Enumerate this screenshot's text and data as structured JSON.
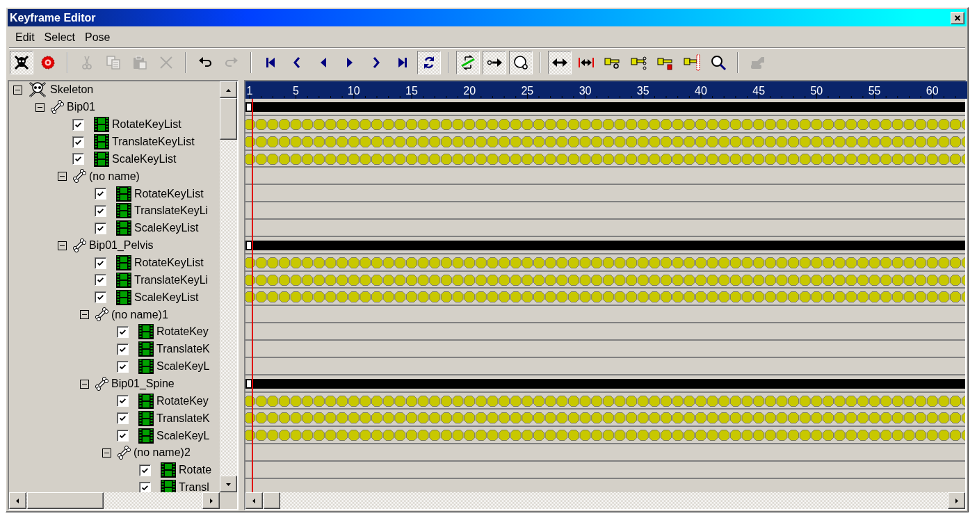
{
  "window": {
    "title": "Keyframe Editor"
  },
  "menu": [
    {
      "label": "Edit"
    },
    {
      "label": "Select"
    },
    {
      "label": "Pose"
    }
  ],
  "toolbar": [
    {
      "kind": "skeleton",
      "pressed": true,
      "disabled": false
    },
    {
      "kind": "target",
      "pressed": false,
      "disabled": false
    },
    {
      "kind": "separator"
    },
    {
      "kind": "cut",
      "pressed": false,
      "disabled": true
    },
    {
      "kind": "copy",
      "pressed": false,
      "disabled": true
    },
    {
      "kind": "paste",
      "pressed": false,
      "disabled": true
    },
    {
      "kind": "delete",
      "pressed": false,
      "disabled": true
    },
    {
      "kind": "separator"
    },
    {
      "kind": "undo",
      "pressed": false,
      "disabled": false
    },
    {
      "kind": "redo",
      "pressed": false,
      "disabled": true
    },
    {
      "kind": "separator"
    },
    {
      "kind": "first",
      "pressed": false,
      "disabled": false
    },
    {
      "kind": "prevkey",
      "pressed": false,
      "disabled": false
    },
    {
      "kind": "prevframe",
      "pressed": false,
      "disabled": false
    },
    {
      "kind": "nextframe",
      "pressed": false,
      "disabled": false
    },
    {
      "kind": "nextkey",
      "pressed": false,
      "disabled": false
    },
    {
      "kind": "last",
      "pressed": false,
      "disabled": false
    },
    {
      "kind": "loop",
      "pressed": true,
      "disabled": false
    },
    {
      "kind": "separator"
    },
    {
      "kind": "sync",
      "pressed": true,
      "disabled": false
    },
    {
      "kind": "keyarrow",
      "pressed": true,
      "disabled": false
    },
    {
      "kind": "lasso",
      "pressed": true,
      "disabled": false
    },
    {
      "kind": "separator"
    },
    {
      "kind": "stretch",
      "pressed": true,
      "disabled": false
    },
    {
      "kind": "range",
      "pressed": false,
      "disabled": false
    },
    {
      "kind": "keychain",
      "pressed": false,
      "disabled": false
    },
    {
      "kind": "keylinks",
      "pressed": false,
      "disabled": false
    },
    {
      "kind": "keyred",
      "pressed": false,
      "disabled": false
    },
    {
      "kind": "keybar",
      "pressed": false,
      "disabled": false
    },
    {
      "kind": "zoom",
      "pressed": false,
      "disabled": false
    },
    {
      "kind": "separator"
    },
    {
      "kind": "hands",
      "pressed": false,
      "disabled": true
    }
  ],
  "tree": {
    "items": [
      {
        "kind": "skeleton",
        "label": "Skeleton",
        "expanded": true,
        "children": [
          {
            "kind": "bone",
            "label": "Bip01",
            "expanded": true,
            "children": [
              {
                "kind": "keylist",
                "label": "RotateKeyList",
                "checked": true
              },
              {
                "kind": "keylist",
                "label": "TranslateKeyList",
                "checked": true
              },
              {
                "kind": "keylist",
                "label": "ScaleKeyList",
                "checked": true
              },
              {
                "kind": "bone",
                "label": "(no name)",
                "expanded": true,
                "children": [
                  {
                    "kind": "keylist",
                    "label": "RotateKeyList",
                    "checked": true
                  },
                  {
                    "kind": "keylist",
                    "label": "TranslateKeyLi",
                    "checked": true
                  },
                  {
                    "kind": "keylist",
                    "label": "ScaleKeyList",
                    "checked": true
                  }
                ]
              },
              {
                "kind": "bone",
                "label": "Bip01_Pelvis",
                "expanded": true,
                "children": [
                  {
                    "kind": "keylist",
                    "label": "RotateKeyList",
                    "checked": true
                  },
                  {
                    "kind": "keylist",
                    "label": "TranslateKeyLi",
                    "checked": true
                  },
                  {
                    "kind": "keylist",
                    "label": "ScaleKeyList",
                    "checked": true
                  },
                  {
                    "kind": "bone",
                    "label": "(no name)1",
                    "expanded": true,
                    "children": [
                      {
                        "kind": "keylist",
                        "label": "RotateKey",
                        "checked": true
                      },
                      {
                        "kind": "keylist",
                        "label": "TranslateK",
                        "checked": true
                      },
                      {
                        "kind": "keylist",
                        "label": "ScaleKeyL",
                        "checked": true
                      }
                    ]
                  },
                  {
                    "kind": "bone",
                    "label": "Bip01_Spine",
                    "expanded": true,
                    "children": [
                      {
                        "kind": "keylist",
                        "label": "RotateKey",
                        "checked": true
                      },
                      {
                        "kind": "keylist",
                        "label": "TranslateK",
                        "checked": true
                      },
                      {
                        "kind": "keylist",
                        "label": "ScaleKeyL",
                        "checked": true
                      },
                      {
                        "kind": "bone",
                        "label": "(no name)2",
                        "expanded": true,
                        "children": [
                          {
                            "kind": "keylist",
                            "label": "Rotate",
                            "checked": true
                          },
                          {
                            "kind": "keylist",
                            "label": "Transl",
                            "checked": true
                          }
                        ]
                      }
                    ]
                  }
                ]
              }
            ]
          }
        ]
      }
    ]
  },
  "timeline": {
    "ruler": [
      "1",
      "5",
      "10",
      "15",
      "20",
      "25",
      "30",
      "35",
      "40",
      "45",
      "50",
      "55",
      "60"
    ],
    "playhead": {
      "level": 0.0087
    },
    "tracks": [
      {
        "kind": "summary"
      },
      {
        "kind": "keys"
      },
      {
        "kind": "keys"
      },
      {
        "kind": "keys"
      },
      {
        "kind": "empty"
      },
      {
        "kind": "empty"
      },
      {
        "kind": "empty"
      },
      {
        "kind": "empty"
      },
      {
        "kind": "summary"
      },
      {
        "kind": "keys"
      },
      {
        "kind": "keys"
      },
      {
        "kind": "keys"
      },
      {
        "kind": "empty"
      },
      {
        "kind": "empty"
      },
      {
        "kind": "empty"
      },
      {
        "kind": "empty"
      },
      {
        "kind": "summary"
      },
      {
        "kind": "keys"
      },
      {
        "kind": "keys"
      },
      {
        "kind": "keys"
      },
      {
        "kind": "empty"
      },
      {
        "kind": "empty"
      },
      {
        "kind": "empty"
      }
    ]
  }
}
